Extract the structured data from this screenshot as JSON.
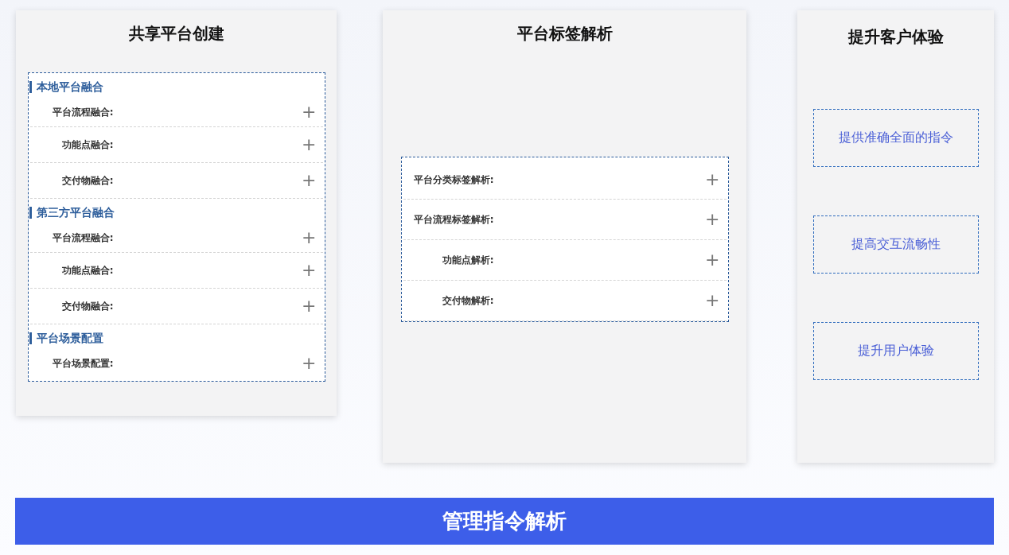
{
  "cards": [
    {
      "title": "共享平台创建",
      "kind": "sections",
      "sections": [
        {
          "heading": "本地平台融合",
          "items": [
            {
              "label": "平台流程融合:",
              "icon": "+"
            },
            {
              "label": "功能点融合:",
              "icon": "+"
            },
            {
              "label": "交付物融合:",
              "icon": "+"
            }
          ]
        },
        {
          "heading": "第三方平台融合",
          "items": [
            {
              "label": "平台流程融合:",
              "icon": "+"
            },
            {
              "label": "功能点融合:",
              "icon": "+"
            },
            {
              "label": "交付物融合:",
              "icon": "+"
            }
          ]
        },
        {
          "heading": "平台场景配置",
          "items": [
            {
              "label": "平台场景配置:",
              "icon": "+"
            }
          ]
        }
      ]
    },
    {
      "title": "平台标签解析",
      "kind": "list",
      "items": [
        {
          "label": "平台分类标签解析:",
          "icon": "+"
        },
        {
          "label": "平台流程标签解析:",
          "icon": "+"
        },
        {
          "label": "功能点解析:",
          "icon": "+"
        },
        {
          "label": "交付物解析:",
          "icon": "+"
        }
      ]
    },
    {
      "title": "提升客户体验",
      "kind": "boxes",
      "boxes": [
        "提供准确全面的指令",
        "提高交互流畅性",
        "提升用户体验"
      ]
    }
  ],
  "banner": "管理指令解析"
}
